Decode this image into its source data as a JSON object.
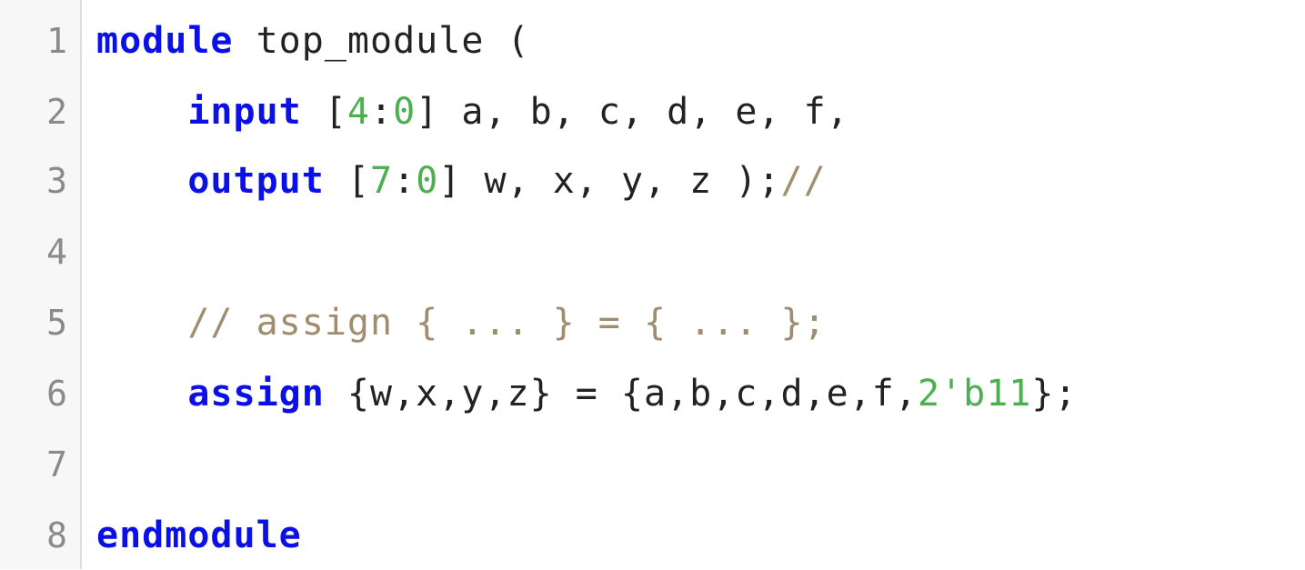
{
  "editor": {
    "lines": [
      {
        "number": "1",
        "tokens": [
          {
            "type": "kw",
            "text": "module"
          },
          {
            "type": "plain",
            "text": " top_module ("
          }
        ]
      },
      {
        "number": "2",
        "tokens": [
          {
            "type": "plain",
            "text": "    "
          },
          {
            "type": "kw",
            "text": "input"
          },
          {
            "type": "plain",
            "text": " ["
          },
          {
            "type": "num",
            "text": "4"
          },
          {
            "type": "plain",
            "text": ":"
          },
          {
            "type": "num",
            "text": "0"
          },
          {
            "type": "plain",
            "text": "] a, b, c, d, e, f,"
          }
        ]
      },
      {
        "number": "3",
        "tokens": [
          {
            "type": "plain",
            "text": "    "
          },
          {
            "type": "kw",
            "text": "output"
          },
          {
            "type": "plain",
            "text": " ["
          },
          {
            "type": "num",
            "text": "7"
          },
          {
            "type": "plain",
            "text": ":"
          },
          {
            "type": "num",
            "text": "0"
          },
          {
            "type": "plain",
            "text": "] w, x, y, z );"
          },
          {
            "type": "cmt",
            "text": "//"
          }
        ]
      },
      {
        "number": "4",
        "tokens": []
      },
      {
        "number": "5",
        "tokens": [
          {
            "type": "plain",
            "text": "    "
          },
          {
            "type": "cmt",
            "text": "// assign { ... } = { ... };"
          }
        ]
      },
      {
        "number": "6",
        "tokens": [
          {
            "type": "plain",
            "text": "    "
          },
          {
            "type": "kw",
            "text": "assign"
          },
          {
            "type": "plain",
            "text": " {w,x,y,z} = {a,b,c,d,e,f,"
          },
          {
            "type": "num",
            "text": "2'b11"
          },
          {
            "type": "plain",
            "text": "};"
          }
        ]
      },
      {
        "number": "7",
        "tokens": []
      },
      {
        "number": "8",
        "tokens": [
          {
            "type": "kw",
            "text": "endmodule"
          }
        ]
      }
    ]
  },
  "colors": {
    "keyword": "#0b10e6",
    "number": "#4caf50",
    "comment": "#a08c6e",
    "text": "#222222",
    "line_number": "#8a8a8a",
    "gutter_background": "#f7f7f7"
  }
}
